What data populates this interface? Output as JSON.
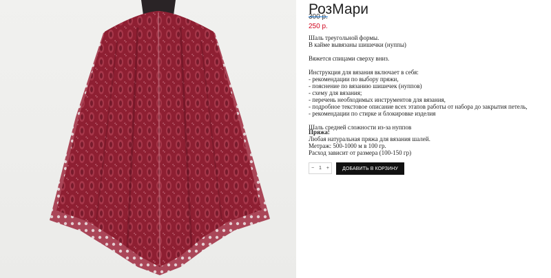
{
  "product": {
    "title": "РозМари",
    "old_price": "300 р.",
    "new_price": "250 р.",
    "image_alt": "shawl-photo"
  },
  "description": {
    "lines": [
      "Шаль треугольной формы.",
      "В кайме вывязаны шишечки (нуппы)",
      "Вяжется спицами сверху вниз.",
      "Инструкция для вязания включает в себя:",
      "- рекомендации по выбору пряжи,",
      "- пояснение по вязанию шишечек (нуппов)",
      "- схему для вязания;",
      "- перечень необходимых инструментов для вязания,",
      "- подробное текстовое описание всех этапов работы от набора до закрытия петель,",
      "- рекомендации по стирке и блокировке изделия",
      "Шаль средней сложности из-за нуппов"
    ]
  },
  "yarn": {
    "title": "Пряжа:",
    "lines": [
      "Любая натуральная пряжа для вязания шалей.",
      "Метраж: 500-1000 м в 100 гр.",
      "Расход зависит от размера (100-150 гр)"
    ]
  },
  "purchase": {
    "minus": "−",
    "quantity": "1",
    "plus": "+",
    "add_to_cart": "ДОБАВИТЬ В КОРЗИНУ"
  },
  "colors": {
    "price_new": "#d0021b",
    "button_bg": "#111111",
    "shawl": "#8e1f32"
  }
}
